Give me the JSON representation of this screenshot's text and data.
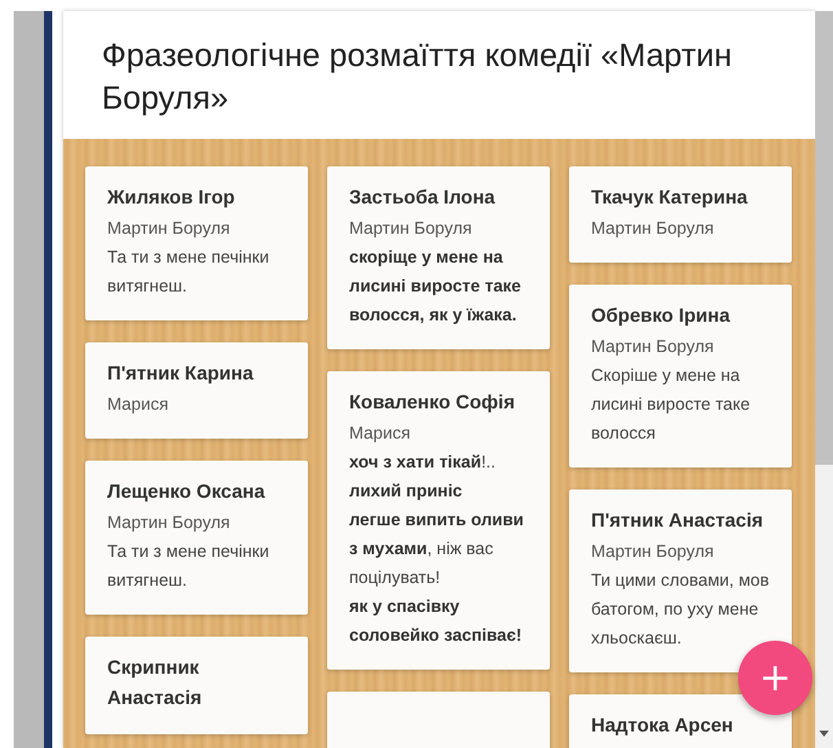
{
  "board": {
    "title": "Фразеологічне розмаїття комедії «Мартин Боруля»",
    "columns": [
      {
        "cards": [
          {
            "author": "Жиляков Ігор",
            "lines": [
              {
                "text": "Мартин Боруля",
                "bold": false
              },
              {
                "text": " Та ти з мене печінки витягнеш.",
                "bold": false
              }
            ]
          },
          {
            "author": "П'ятник Карина",
            "lines": [
              {
                "text": "Марися",
                "bold": false
              }
            ]
          },
          {
            "author": "Лещенко Оксана",
            "lines": [
              {
                "text": "Мартин Боруля",
                "bold": false
              },
              {
                "text": "Та ти з мене печінки витягнеш.",
                "bold": false
              }
            ]
          },
          {
            "author": "Скрипник Анастасія"
          }
        ]
      },
      {
        "cards": [
          {
            "author": "Застьоба Ілона",
            "lines": [
              {
                "text": "Мартин Боруля",
                "bold": false
              },
              {
                "text": "скоріще у мене на лисині виросте таке волосся, як у їжака.",
                "bold": true
              }
            ]
          },
          {
            "author": "Коваленко Софія",
            "lines": [
              {
                "text": "Марися",
                "bold": false
              },
              {
                "text": "**хоч з хати тікай**!..",
                "bold": false
              },
              {
                "text": "лихий приніс",
                "bold": true
              },
              {
                "text": "**легше випить оливи з мухами**, ніж вас поцілувать!",
                "bold": false
              },
              {
                "text": "як у спасівку соловейко заспіває!",
                "bold": true
              }
            ]
          }
        ]
      },
      {
        "cards": [
          {
            "author": "Ткачук Катерина",
            "lines": [
              {
                "text": "Мартин Боруля",
                "bold": false
              }
            ]
          },
          {
            "author": "Обревко Ірина",
            "lines": [
              {
                "text": "Мартин Боруля",
                "bold": false
              },
              {
                "text": "Скоріше у мене на лисині  виросте таке волосся",
                "bold": false
              }
            ]
          },
          {
            "author": "П'ятник Анастасія",
            "lines": [
              {
                "text": "Мартин Боруля",
                "bold": false
              },
              {
                "text": " Ти цими словами, мов батогом, по уху мене хльоскаєш.",
                "bold": false
              }
            ]
          },
          {
            "author": "Надтока Арсен"
          }
        ]
      }
    ]
  },
  "add_button": {
    "label": "+"
  }
}
